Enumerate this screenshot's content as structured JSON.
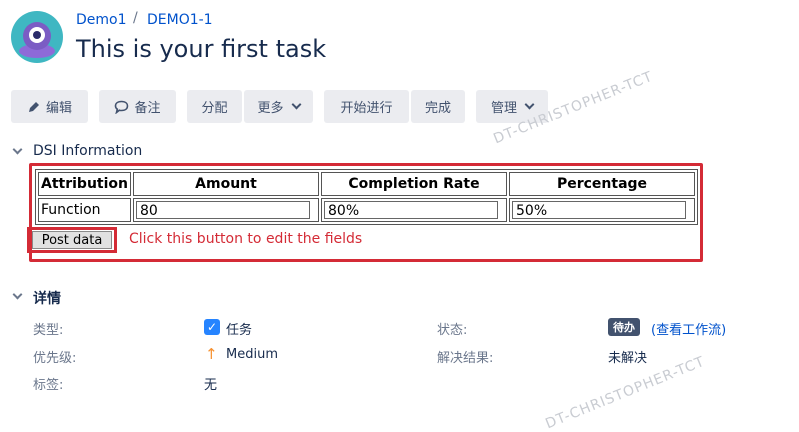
{
  "breadcrumb": {
    "project": "Demo1",
    "separator": "/",
    "issue_key": "DEMO1-1"
  },
  "issue": {
    "title": "This is your first task"
  },
  "toolbar": {
    "edit": "编辑",
    "comment": "备注",
    "assign": "分配",
    "more": "更多",
    "start_progress": "开始进行",
    "done": "完成",
    "admin": "管理"
  },
  "watermark": "DT-CHRISTOPHER-TCT",
  "dsi": {
    "title": "DSI Information",
    "headers": [
      "Attribution",
      "Amount",
      "Completion Rate",
      "Percentage"
    ],
    "row_label": "Function",
    "values": {
      "amount": "80",
      "completion_rate": "80%",
      "percentage": "50%"
    },
    "post_button": "Post data",
    "hint": "Click this button to edit the fields"
  },
  "details": {
    "title": "详情",
    "type_label": "类型:",
    "type_value": "任务",
    "priority_label": "优先级:",
    "priority_value": "Medium",
    "labels_label": "标签:",
    "labels_value": "无",
    "status_label": "状态:",
    "status_value": "待办",
    "view_workflow": "(查看工作流)",
    "resolution_label": "解决结果:",
    "resolution_value": "未解决"
  },
  "colors": {
    "accent": "#0052cc",
    "highlight": "#d42b36",
    "status_badge": "#42526e",
    "priority": "#f79232"
  }
}
